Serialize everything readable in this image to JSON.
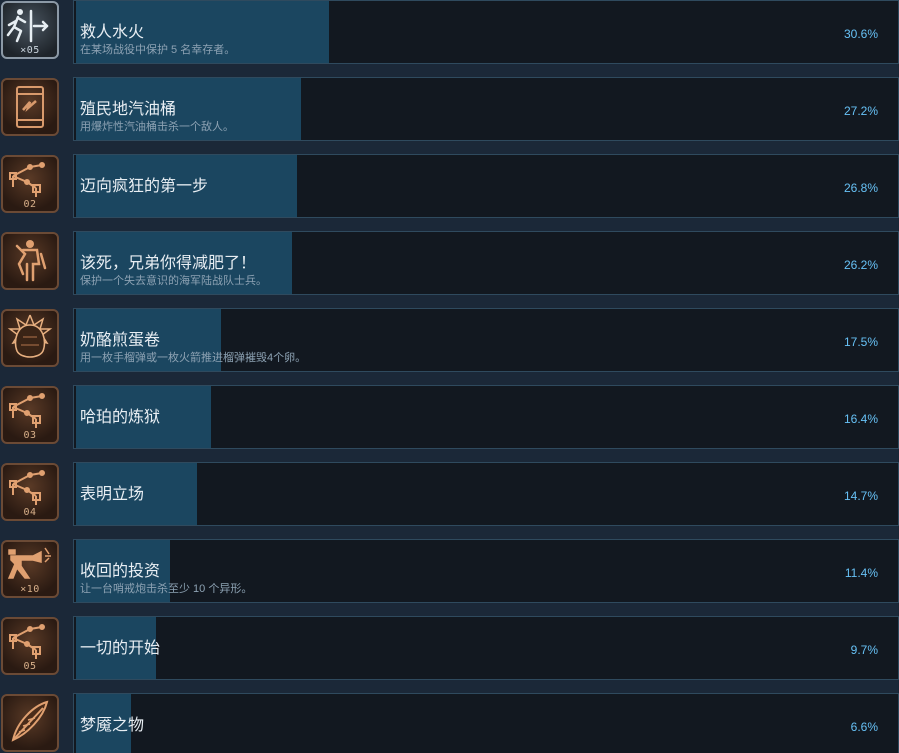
{
  "achievements": [
    {
      "title": "救人水火",
      "desc": "在某场战役中保护 5 名幸存者。",
      "percent_label": "30.6%",
      "percent": 30.6,
      "icon": "exit-running-man-icon",
      "count": "×05",
      "icon_style": "grey"
    },
    {
      "title": "殖民地汽油桶",
      "desc": "用爆炸性汽油桶击杀一个敌人。",
      "percent_label": "27.2%",
      "percent": 27.2,
      "icon": "explosive-barrel-icon",
      "count": "",
      "icon_style": "brown"
    },
    {
      "title": "迈向疯狂的第一步",
      "desc": "",
      "percent_label": "26.8%",
      "percent": 26.8,
      "icon": "map-path-icon",
      "count": "02",
      "icon_style": "brown"
    },
    {
      "title": "该死，兄弟你得减肥了！",
      "desc": "保护一个失去意识的海军陆战队士兵。",
      "percent_label": "26.2%",
      "percent": 26.2,
      "icon": "carry-marine-icon",
      "count": "",
      "icon_style": "brown"
    },
    {
      "title": "奶酪煎蛋卷",
      "desc": "用一枚手榴弹或一枚火箭推进榴弹摧毁4个卵。",
      "percent_label": "17.5%",
      "percent": 17.5,
      "icon": "alien-egg-icon",
      "count": "",
      "icon_style": "brown"
    },
    {
      "title": "哈珀的炼狱",
      "desc": "",
      "percent_label": "16.4%",
      "percent": 16.4,
      "icon": "map-path-icon",
      "count": "03",
      "icon_style": "brown"
    },
    {
      "title": "表明立场",
      "desc": "",
      "percent_label": "14.7%",
      "percent": 14.7,
      "icon": "map-path-icon",
      "count": "04",
      "icon_style": "brown"
    },
    {
      "title": "收回的投资",
      "desc": "让一台哨戒炮击杀至少 10 个异形。",
      "percent_label": "11.4%",
      "percent": 11.4,
      "icon": "sentry-gun-icon",
      "count": "×10",
      "icon_style": "brown"
    },
    {
      "title": "一切的开始",
      "desc": "",
      "percent_label": "9.7%",
      "percent": 9.7,
      "icon": "map-path-icon",
      "count": "05",
      "icon_style": "brown"
    },
    {
      "title": "梦魇之物",
      "desc": "",
      "percent_label": "6.6%",
      "percent": 6.6,
      "icon": "feather-quill-icon",
      "count": "",
      "icon_style": "brown"
    }
  ],
  "colors": {
    "bar": "#1b4660",
    "percent_text": "#67c1f5",
    "panel_border": "#2f4a5e"
  }
}
